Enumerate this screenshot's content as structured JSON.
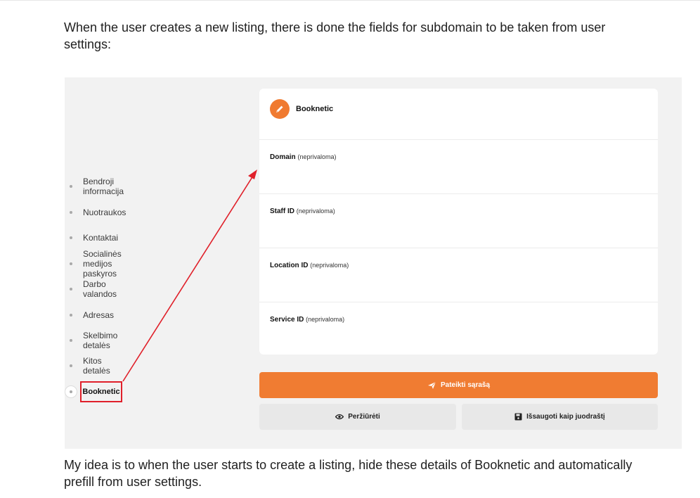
{
  "intro_text": "When the user creates a new listing, there is done the fields for subdomain to be taken from user settings:",
  "outro_text": "My idea is to when the user starts to create a listing, hide these details of Booknetic and automatically prefill from user settings.",
  "nav": {
    "items": [
      {
        "label": "Bendroji informacija"
      },
      {
        "label": "Nuotraukos"
      },
      {
        "label": "Kontaktai"
      },
      {
        "label": "Socialinės medijos paskyros"
      },
      {
        "label": "Darbo valandos"
      },
      {
        "label": "Adresas"
      },
      {
        "label": "Skelbimo detalės"
      },
      {
        "label": "Kitos detalės"
      }
    ],
    "active_label": "Booknetic"
  },
  "card": {
    "title": "Booknetic",
    "icon": "pencil-icon",
    "fields": [
      {
        "label": "Domain",
        "optional": "(neprivaloma)"
      },
      {
        "label": "Staff ID",
        "optional": "(neprivaloma)"
      },
      {
        "label": "Location ID",
        "optional": "(neprivaloma)"
      },
      {
        "label": "Service ID",
        "optional": "(neprivaloma)"
      }
    ]
  },
  "actions": {
    "submit_label": "Pateikti sąrašą",
    "preview_label": "Peržiūrėti",
    "draft_label": "Išsaugoti kaip juodraštį"
  },
  "colors": {
    "accent": "#f07c32",
    "highlight": "#e0202a",
    "panel_bg": "#f2f2f2"
  }
}
